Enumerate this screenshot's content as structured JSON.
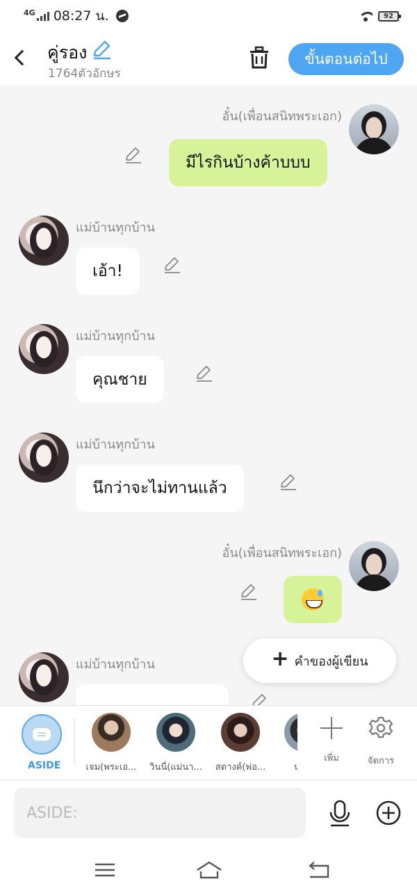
{
  "status_bar": {
    "network": "4G",
    "time": "08:27 น.",
    "battery": "92"
  },
  "header": {
    "title": "คู่รอง",
    "subtitle": "1764ตัวอักษร",
    "next_button": "ขั้นตอนต่อไป"
  },
  "messages": [
    {
      "side": "right",
      "sender": "อั๋น(เพื่อนสนิทพระเอก)",
      "text": "มีไรกินบ้างค้าบบบ",
      "avatar": "male-avatar"
    },
    {
      "side": "left",
      "sender": "แม่บ้านทุกบ้าน",
      "text": "เอ้า!",
      "avatar": "female-avatar"
    },
    {
      "side": "left",
      "sender": "แม่บ้านทุกบ้าน",
      "text": "คุณชาย",
      "avatar": "female-avatar"
    },
    {
      "side": "left",
      "sender": "แม่บ้านทุกบ้าน",
      "text": "นึกว่าจะไม่ทานแล้ว",
      "avatar": "female-avatar"
    },
    {
      "side": "right",
      "sender": "อั๋น(เพื่อนสนิทพระเอก)",
      "text": "",
      "emoji": "grinning-sweat-emoji",
      "avatar": "male-avatar"
    },
    {
      "side": "left",
      "sender": "แม่บ้านทุกบ้าน",
      "text": "",
      "avatar": "female-avatar"
    }
  ],
  "fab": {
    "label": "คำของผู้เขียน"
  },
  "character_bar": {
    "aside_label": "ASIDE",
    "characters": [
      {
        "name": "เจม(พระเอ..."
      },
      {
        "name": "วินนี่(แม่นา..."
      },
      {
        "name": "สตางค์(พ่อ..."
      },
      {
        "name": "นายเ"
      }
    ],
    "add_label": "เพิ่ม",
    "manage_label": "จัดการ"
  },
  "input": {
    "placeholder": "ASIDE:"
  },
  "colors": {
    "accent": "#4ea5f2",
    "my_bubble": "#d7f39a",
    "other_bubble": "#ffffff",
    "background": "#f5f5f5"
  }
}
